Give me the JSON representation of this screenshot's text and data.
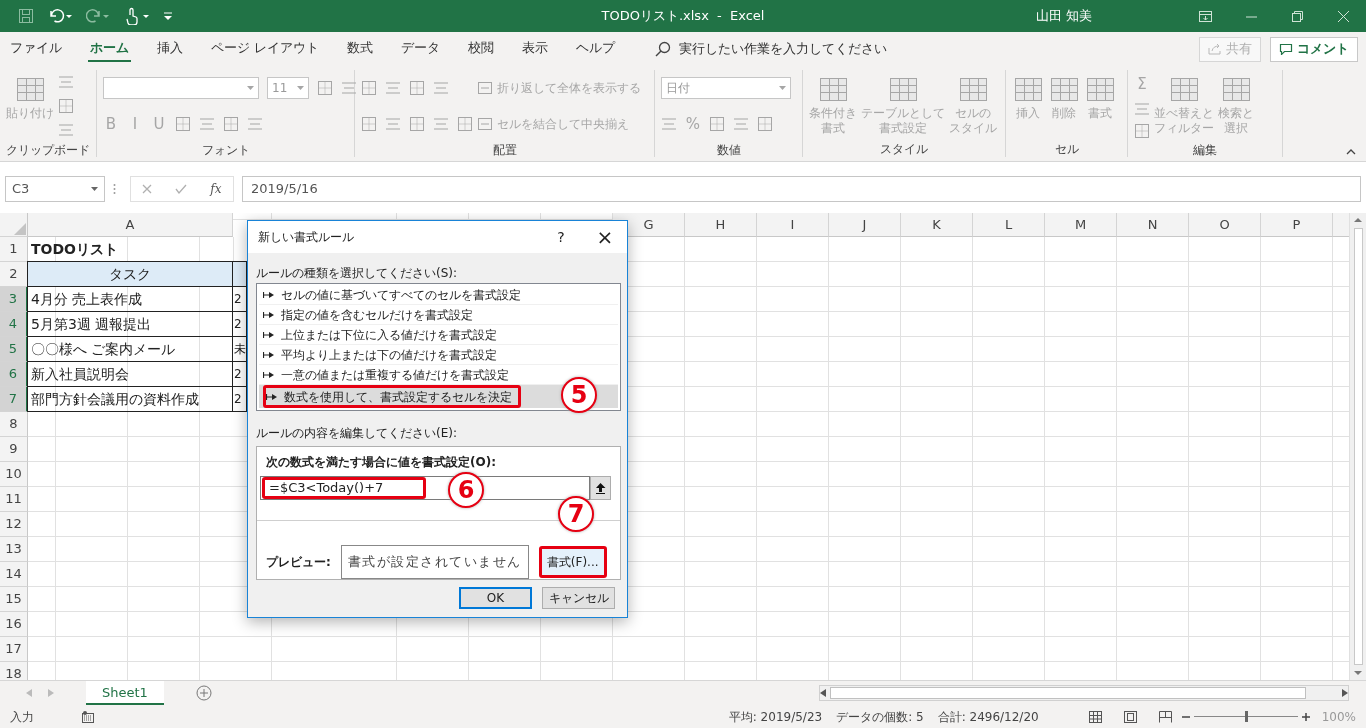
{
  "window": {
    "title": "TODOリスト.xlsx  -  Excel",
    "user": "山田 知美"
  },
  "ribbon_tabs": [
    {
      "label": "ファイル",
      "selected": false
    },
    {
      "label": "ホーム",
      "selected": true
    },
    {
      "label": "挿入",
      "selected": false
    },
    {
      "label": "ページ レイアウト",
      "selected": false
    },
    {
      "label": "数式",
      "selected": false
    },
    {
      "label": "データ",
      "selected": false
    },
    {
      "label": "校閲",
      "selected": false
    },
    {
      "label": "表示",
      "selected": false
    },
    {
      "label": "ヘルプ",
      "selected": false
    }
  ],
  "tell_me": "実行したい作業を入力してください",
  "share_button": "共有",
  "comment_button": "コメント",
  "ribbon_groups": [
    {
      "label": "クリップボード",
      "items": [
        {
          "kind": "large",
          "lines": [
            "貼り付け"
          ]
        },
        {
          "kind": "column",
          "rows": [
            [
              {
                "kind": "icon"
              }
            ],
            [
              {
                "kind": "icon"
              }
            ],
            [
              {
                "kind": "icon"
              }
            ]
          ]
        }
      ]
    },
    {
      "label": "フォント",
      "items": [
        {
          "kind": "column",
          "rows": [
            [
              {
                "kind": "field-wide"
              },
              {
                "kind": "field",
                "value": "11"
              },
              {
                "kind": "icon"
              },
              {
                "kind": "icon"
              }
            ],
            [
              {
                "kind": "glyph",
                "text": "B"
              },
              {
                "kind": "glyph",
                "text": "I"
              },
              {
                "kind": "glyph",
                "text": "U"
              },
              {
                "kind": "icon"
              },
              {
                "kind": "icon"
              },
              {
                "kind": "icon"
              },
              {
                "kind": "icon"
              }
            ]
          ]
        }
      ]
    },
    {
      "label": "配置",
      "items": [
        {
          "kind": "column",
          "rows": [
            [
              {
                "kind": "icon"
              },
              {
                "kind": "icon"
              },
              {
                "kind": "icon"
              },
              {
                "kind": "icon"
              }
            ],
            [
              {
                "kind": "icon"
              },
              {
                "kind": "icon"
              },
              {
                "kind": "icon"
              },
              {
                "kind": "icon"
              },
              {
                "kind": "icon"
              }
            ]
          ]
        },
        {
          "kind": "column",
          "rows": [
            [
              {
                "kind": "small",
                "text": "折り返して全体を表示する"
              }
            ],
            [
              {
                "kind": "small",
                "text": "セルを結合して中央揃え"
              }
            ]
          ]
        }
      ]
    },
    {
      "label": "数値",
      "items": [
        {
          "kind": "column",
          "rows": [
            [
              {
                "kind": "field-wide",
                "value": "日付"
              }
            ],
            [
              {
                "kind": "icon"
              },
              {
                "kind": "glyph",
                "text": "%"
              },
              {
                "kind": "icon"
              },
              {
                "kind": "icon"
              },
              {
                "kind": "icon"
              }
            ]
          ]
        }
      ]
    },
    {
      "label": "スタイル",
      "items": [
        {
          "kind": "large",
          "lines": [
            "条件付き",
            "書式"
          ]
        },
        {
          "kind": "large",
          "lines": [
            "テーブルとして",
            "書式設定"
          ]
        },
        {
          "kind": "large",
          "lines": [
            "セルの",
            "スタイル"
          ]
        }
      ]
    },
    {
      "label": "セル",
      "items": [
        {
          "kind": "large",
          "lines": [
            "挿入"
          ]
        },
        {
          "kind": "large",
          "lines": [
            "削除"
          ]
        },
        {
          "kind": "large",
          "lines": [
            "書式"
          ]
        }
      ]
    },
    {
      "label": "編集",
      "items": [
        {
          "kind": "column",
          "rows": [
            [
              {
                "kind": "glyph",
                "text": "Σ"
              }
            ],
            [
              {
                "kind": "icon"
              }
            ],
            [
              {
                "kind": "icon"
              }
            ]
          ]
        },
        {
          "kind": "large",
          "lines": [
            "並べ替えと",
            "フィルター"
          ]
        },
        {
          "kind": "large",
          "lines": [
            "検索と",
            "選択"
          ]
        }
      ]
    }
  ],
  "formula_bar": {
    "name_box": "C3",
    "fx": "fx",
    "value": "2019/5/16"
  },
  "sheet": {
    "columns": [
      "A",
      "G",
      "H",
      "I",
      "J",
      "K",
      "L",
      "M",
      "N",
      "O",
      "P"
    ],
    "rows": [
      {
        "number": "1",
        "selected": false,
        "cells": [
          {
            "kind": "title",
            "text": "TODOリスト"
          }
        ]
      },
      {
        "number": "2",
        "selected": false,
        "cells": [
          {
            "kind": "header",
            "text": "タスク"
          },
          {
            "kind": "header"
          }
        ]
      },
      {
        "number": "3",
        "selected": true,
        "cells": [
          {
            "kind": "task",
            "text": "4月分 売上表作成"
          },
          {
            "kind": "task",
            "text": "2"
          }
        ]
      },
      {
        "number": "4",
        "selected": true,
        "cells": [
          {
            "kind": "task",
            "text": "5月第3週 週報提出"
          },
          {
            "kind": "task",
            "text": "2"
          }
        ]
      },
      {
        "number": "5",
        "selected": true,
        "cells": [
          {
            "kind": "task",
            "text": "〇〇様へ ご案内メール"
          },
          {
            "kind": "task",
            "text": "未"
          }
        ]
      },
      {
        "number": "6",
        "selected": true,
        "cells": [
          {
            "kind": "task",
            "text": "新入社員説明会"
          },
          {
            "kind": "task",
            "text": "2"
          }
        ]
      },
      {
        "number": "7",
        "selected": true,
        "cells": [
          {
            "kind": "task",
            "text": "部門方針会議用の資料作成"
          },
          {
            "kind": "task",
            "text": "2"
          }
        ]
      },
      {
        "number": "8",
        "selected": false,
        "cells": []
      },
      {
        "number": "9",
        "selected": false,
        "cells": []
      },
      {
        "number": "10",
        "selected": false,
        "cells": []
      },
      {
        "number": "11",
        "selected": false,
        "cells": []
      },
      {
        "number": "12",
        "selected": false,
        "cells": []
      },
      {
        "number": "13",
        "selected": false,
        "cells": []
      },
      {
        "number": "14",
        "selected": false,
        "cells": []
      },
      {
        "number": "15",
        "selected": false,
        "cells": []
      },
      {
        "number": "16",
        "selected": false,
        "cells": []
      },
      {
        "number": "17",
        "selected": false,
        "cells": []
      },
      {
        "number": "18",
        "selected": false,
        "cells": []
      }
    ]
  },
  "dialog": {
    "title": "新しい書式ルール",
    "help": "?",
    "close": "×",
    "rule_type_label": "ルールの種類を選択してください(S):",
    "rule_types": [
      {
        "label": "セルの値に基づいてすべてのセルを書式設定",
        "selected": false
      },
      {
        "label": "指定の値を含むセルだけを書式設定",
        "selected": false
      },
      {
        "label": "上位または下位に入る値だけを書式設定",
        "selected": false
      },
      {
        "label": "平均より上または下の値だけを書式設定",
        "selected": false
      },
      {
        "label": "一意の値または重複する値だけを書式設定",
        "selected": false
      },
      {
        "label": "数式を使用して、書式設定するセルを決定",
        "selected": true
      }
    ],
    "edit_label": "ルールの内容を編集してください(E):",
    "formula_label": "次の数式を満たす場合に値を書式設定(O):",
    "formula": "=$C3<Today()+7",
    "preview_label": "プレビュー:",
    "preview_text": "書式が設定されていません",
    "format_button": "書式(F)...",
    "ok_button": "OK",
    "cancel_button": "キャンセル"
  },
  "annotations": [
    {
      "kind": "rule",
      "number": "5"
    },
    {
      "kind": "formula",
      "number": "6"
    },
    {
      "kind": "format",
      "number": "7"
    }
  ],
  "sheet_tabs": [
    {
      "label": "Sheet1",
      "selected": true
    }
  ],
  "status_bar": {
    "mode": "入力",
    "stats": [
      "平均: 2019/5/23",
      "データの個数: 5",
      "合計: 2496/12/20"
    ],
    "zoom": "100%",
    "zoom_slider": {
      "level": 0.5
    }
  }
}
